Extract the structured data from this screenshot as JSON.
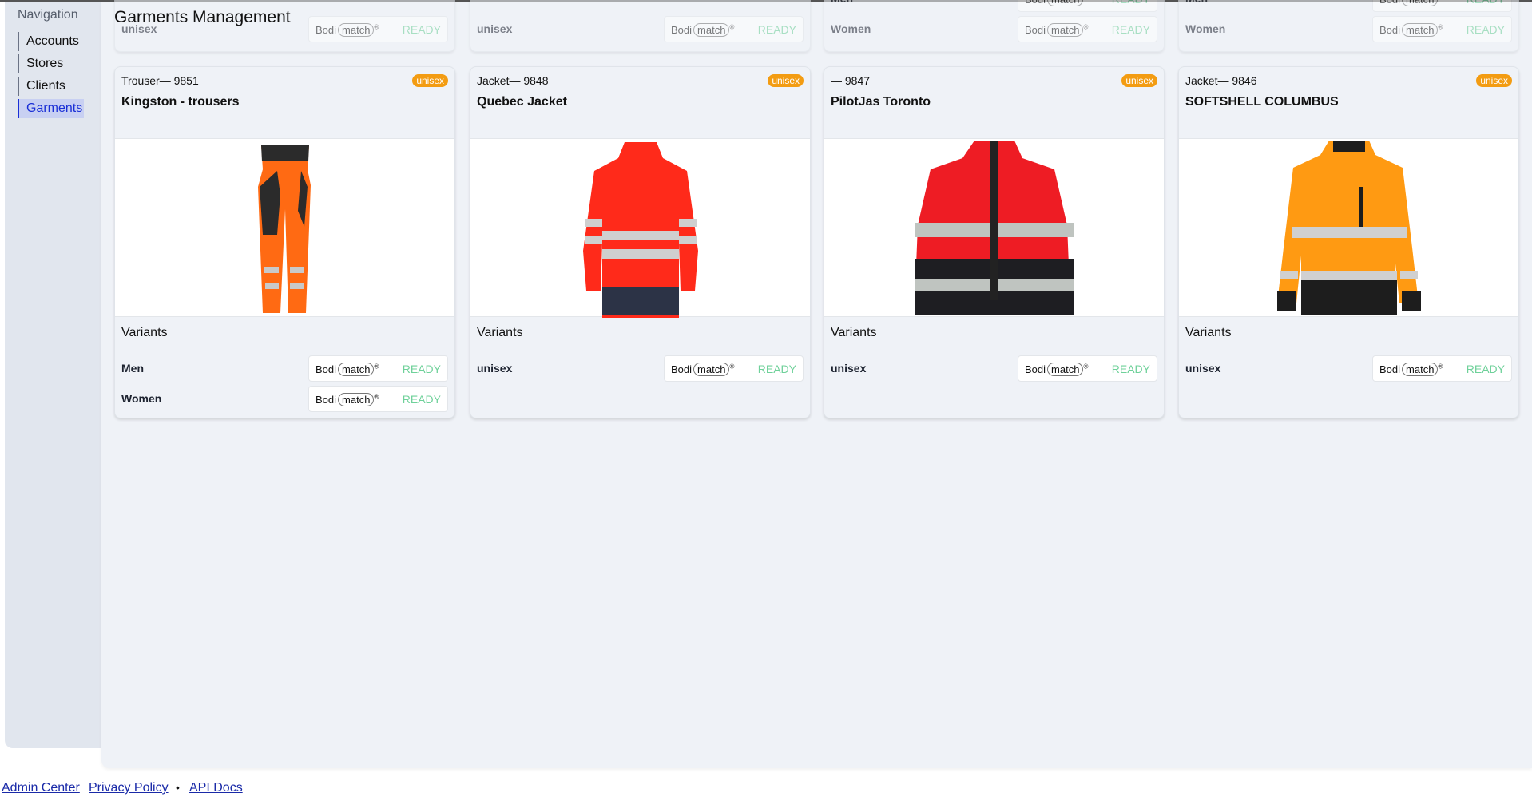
{
  "nav": {
    "title": "Navigation",
    "items": [
      {
        "label": "Accounts"
      },
      {
        "label": "Stores"
      },
      {
        "label": "Clients"
      },
      {
        "label": "Garments",
        "active": true
      }
    ]
  },
  "page_title": "Garments Management",
  "top_cards": [
    {
      "variants": [
        {
          "name": "unisex",
          "status": "READY"
        }
      ]
    },
    {
      "variants": [
        {
          "name": "unisex",
          "status": "READY"
        }
      ]
    },
    {
      "variants": [
        {
          "name": "Men",
          "status": "READY"
        },
        {
          "name": "Women",
          "status": "READY"
        }
      ]
    },
    {
      "variants": [
        {
          "name": "Men",
          "status": "READY"
        },
        {
          "name": "Women",
          "status": "READY"
        }
      ]
    }
  ],
  "variants_label": "Variants",
  "logo": {
    "bodi": "Bodi",
    "match": "match",
    "reg": "®"
  },
  "cards": [
    {
      "meta": "Trouser— 9851",
      "badge": "unisex",
      "name": "Kingston - trousers",
      "image": "trousers",
      "variants": [
        {
          "name": "Men",
          "status": "READY"
        },
        {
          "name": "Women",
          "status": "READY"
        }
      ]
    },
    {
      "meta": "Jacket— 9848",
      "badge": "unisex",
      "name": "Quebec Jacket",
      "image": "jacket-red",
      "variants": [
        {
          "name": "unisex",
          "status": "READY"
        }
      ]
    },
    {
      "meta": "— 9847",
      "badge": "unisex",
      "name": "PilotJas Toronto",
      "image": "jacket-red-black",
      "variants": [
        {
          "name": "unisex",
          "status": "READY"
        }
      ]
    },
    {
      "meta": "Jacket— 9846",
      "badge": "unisex",
      "name": "SOFTSHELL COLUMBUS",
      "image": "jacket-orange",
      "variants": [
        {
          "name": "unisex",
          "status": "READY"
        }
      ]
    }
  ],
  "footer": {
    "links": [
      "Admin Center",
      "Privacy Policy",
      "API Docs"
    ],
    "separator": "•"
  },
  "colors": {
    "badge": "#f39c12",
    "ready": "#6fd19a",
    "active_nav": "#1a2fd6",
    "link": "#1a2aa8"
  }
}
